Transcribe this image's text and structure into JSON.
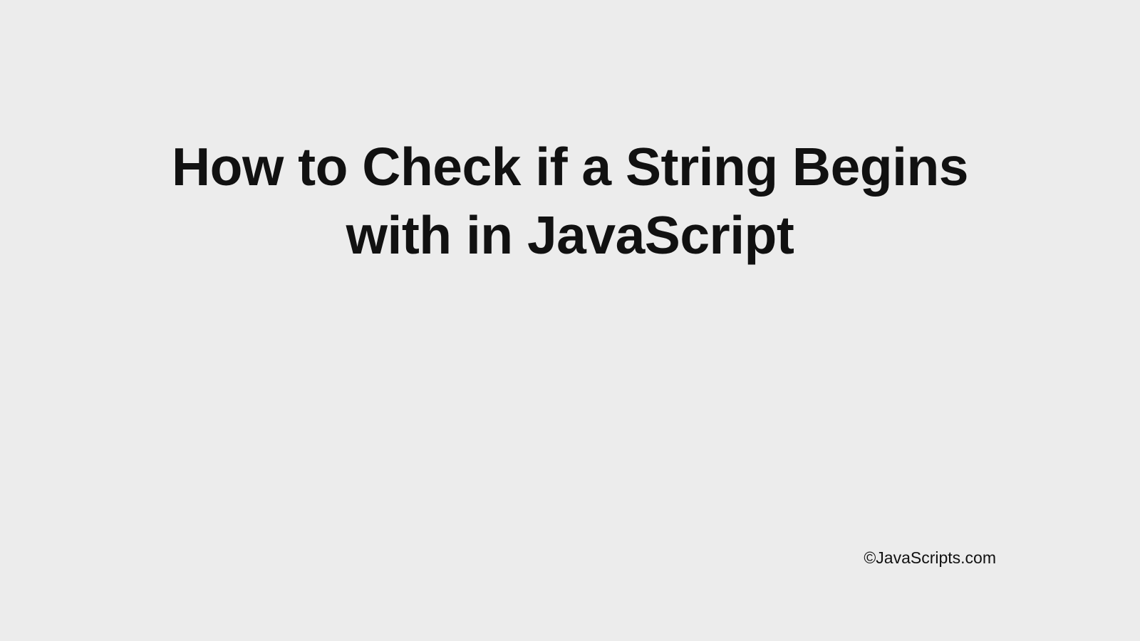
{
  "heading": {
    "title": "How to Check if a String Begins with in JavaScript"
  },
  "footer": {
    "attribution": "©JavaScripts.com"
  }
}
